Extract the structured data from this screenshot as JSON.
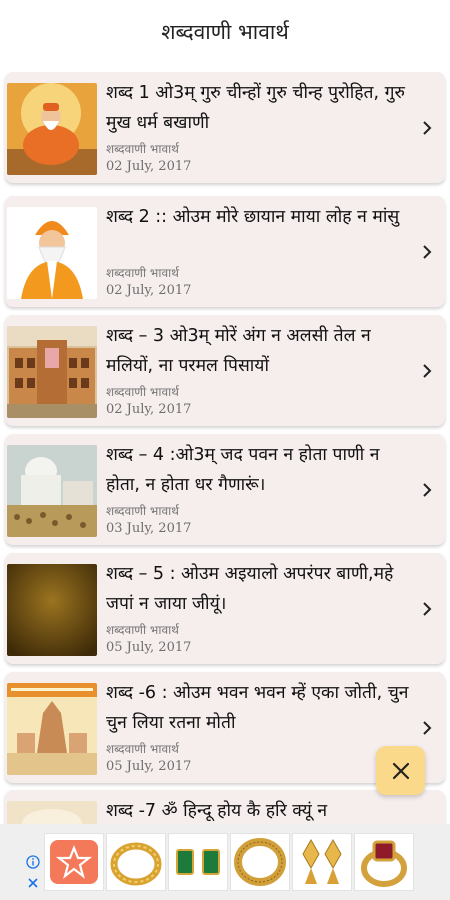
{
  "app_bar": {
    "title": "शब्दवाणी भावार्थ"
  },
  "posts": [
    {
      "title": "शब्द 1  ओ3म् गुरु चीन्हों गुरु चीन्ह पुरोहित, गुरु मुख धर्म बखाणी",
      "category": "शब्दवाणी भावार्थ",
      "date": "02 July, 2017",
      "thumbnail": "guru-meditating-image"
    },
    {
      "title": "शब्द 2 :: ओउम मोरे छायान माया लोह न मांसु",
      "category": "शब्दवाणी भावार्थ",
      "date": "02 July, 2017",
      "thumbnail": "guru-portrait-image"
    },
    {
      "title": "शब्द – 3 ओ3म् मोरें अंग न अलसी तेल न मलियों, ना परमल पिसायों",
      "category": "शब्दवाणी भावार्थ",
      "date": "02 July, 2017",
      "thumbnail": "temple-building-image"
    },
    {
      "title": "शब्द – 4 :ओ3म् जद पवन न होता पाणी न होता, न होता धर गैणारूं।",
      "category": "शब्दवाणी भावार्थ",
      "date": "03 July, 2017",
      "thumbnail": "dome-temple-image"
    },
    {
      "title": "शब्द – 5  : ओउम अइयालो अपरंपर बाणी,महे जपां न जाया जीयूं।",
      "category": "शब्दवाणी भावार्थ",
      "date": "05 July, 2017",
      "thumbnail": "golden-texture-image"
    },
    {
      "title": "शब्द -6 : ओउम भवन भवन म्हें एका जोती, चुन चुन लिया रतना मोती",
      "category": "शब्दवाणी भावार्थ",
      "date": "05 July, 2017",
      "thumbnail": "temple-banner-image"
    },
    {
      "title": "शब्द -7 ॐ हिन्दू होय कै हरि क्यूं न",
      "category": "",
      "date": "",
      "thumbnail": "pale-image"
    }
  ],
  "fab": {
    "icon": "close-icon"
  },
  "ad_banner": {
    "icons": [
      "ad-info-icon",
      "ad-close-icon"
    ],
    "tiles": [
      "brand-logo",
      "gold-ring",
      "emerald-earrings",
      "gold-band-ring",
      "gold-earrings",
      "ruby-ring"
    ]
  },
  "colors": {
    "card_bg": "#f6eded",
    "fab_bg": "#fbd98a",
    "ad_bg": "#efefef"
  }
}
